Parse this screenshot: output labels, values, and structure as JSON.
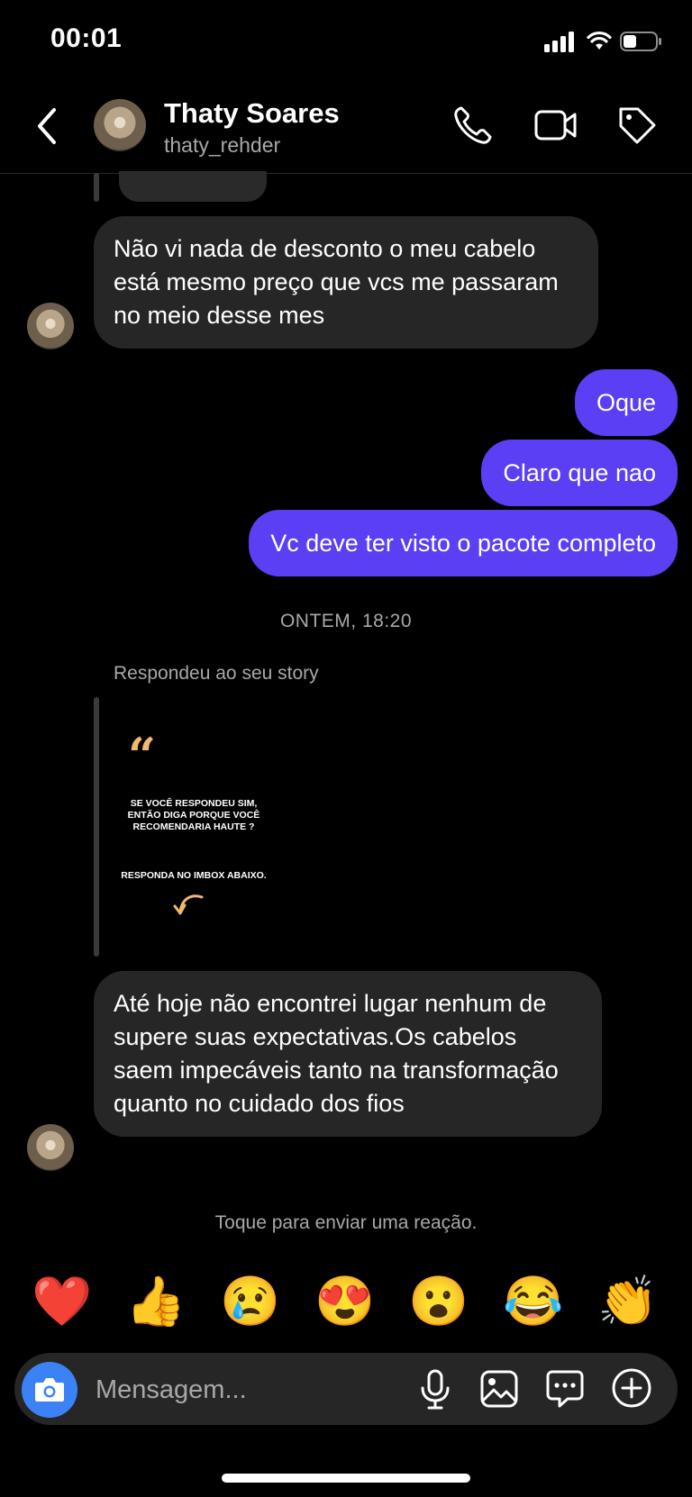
{
  "status_bar": {
    "time": "00:01"
  },
  "header": {
    "name": "Thaty Soares",
    "handle": "thaty_rehder"
  },
  "messages": [
    {
      "side": "in",
      "text": "Não vi nada de desconto o meu cabelo está mesmo preço que vcs me passaram no meio desse mes"
    },
    {
      "side": "out",
      "text": "Oque"
    },
    {
      "side": "out",
      "text": "Claro que nao"
    },
    {
      "side": "out",
      "text": "Vc deve ter visto o pacote completo"
    },
    {
      "side": "in",
      "text": "Até hoje não encontrei lugar nenhum de supere suas expectativas.Os cabelos saem impecáveis tanto na transformação quanto no cuidado dos fios"
    }
  ],
  "timestamp": "ONTEM, 18:20",
  "story_reply": {
    "label": "Respondeu ao seu story",
    "quote_mark": "“",
    "text1": "SE VOCÊ RESPONDEU SIM, ENTÃO DIGA PORQUE VOCÊ RECOMENDARIA HAUTE ?",
    "text2": "RESPONDA NO IMBOX ABAIXO."
  },
  "reaction_hint": "Toque para enviar uma reação.",
  "reactions": [
    "❤️",
    "👍",
    "😢",
    "😍",
    "😮",
    "😂",
    "👏"
  ],
  "composer": {
    "placeholder": "Mensagem..."
  },
  "colors": {
    "outgoing_bubble": "#5b3ff5",
    "incoming_bubble": "#262626",
    "camera_button": "#3b82f6",
    "story_accent": "#f2b86e"
  }
}
